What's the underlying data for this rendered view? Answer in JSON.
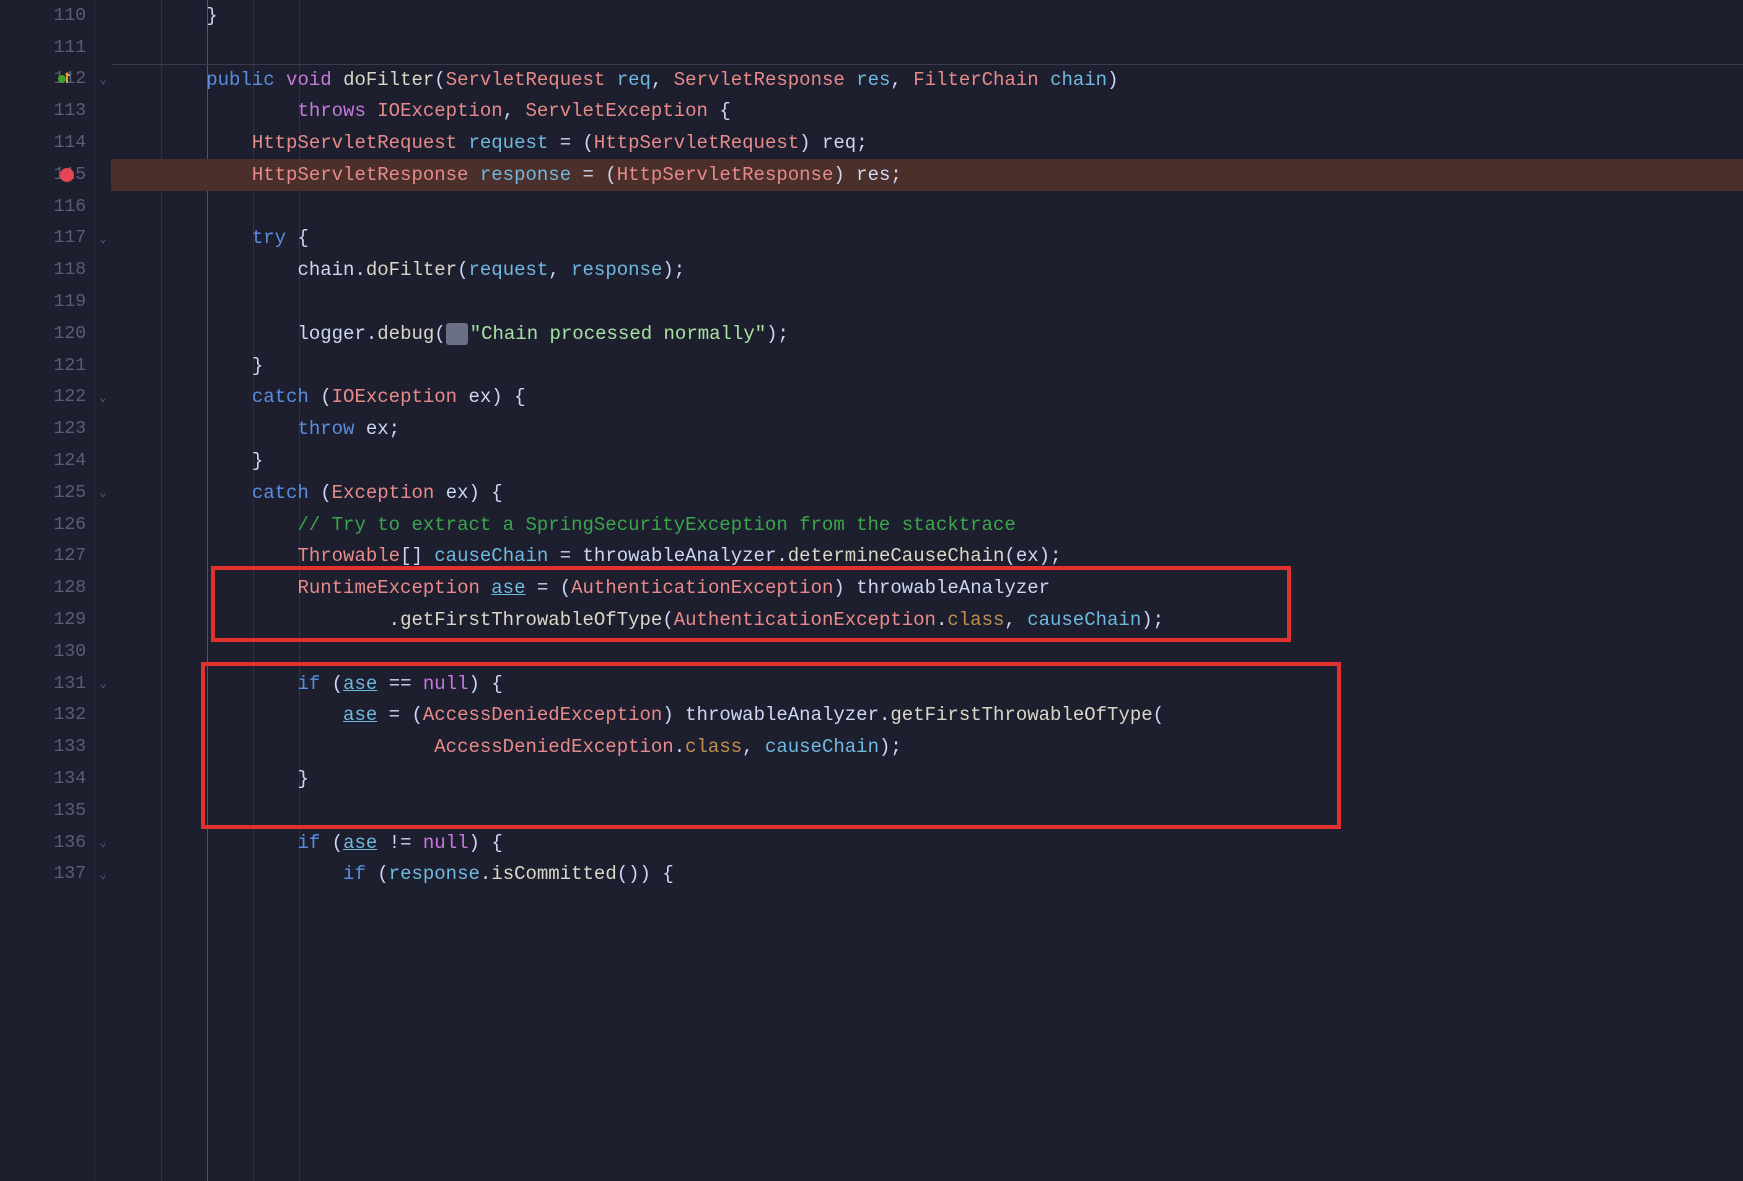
{
  "gutter": {
    "start": 110,
    "end": 137,
    "breakpoint_line": 115,
    "override_line": 112
  },
  "code": {
    "lines": [
      {
        "n": 110,
        "indent": 2,
        "tokens": [
          [
            "punct",
            "}"
          ]
        ]
      },
      {
        "n": 111,
        "indent": 0,
        "tokens": []
      },
      {
        "n": 112,
        "indent": 2,
        "ruler": true,
        "tokens": [
          [
            "kw",
            "public"
          ],
          [
            "sp",
            " "
          ],
          [
            "kw2",
            "void"
          ],
          [
            "sp",
            " "
          ],
          [
            "method",
            "doFilter"
          ],
          [
            "punct",
            "("
          ],
          [
            "type",
            "ServletRequest"
          ],
          [
            "sp",
            " "
          ],
          [
            "var",
            "req"
          ],
          [
            "punct",
            ", "
          ],
          [
            "type",
            "ServletResponse"
          ],
          [
            "sp",
            " "
          ],
          [
            "var",
            "res"
          ],
          [
            "punct",
            ", "
          ],
          [
            "type",
            "FilterChain"
          ],
          [
            "sp",
            " "
          ],
          [
            "var",
            "chain"
          ],
          [
            "punct",
            ")"
          ]
        ]
      },
      {
        "n": 113,
        "indent": 4,
        "tokens": [
          [
            "kw2",
            "throws"
          ],
          [
            "sp",
            " "
          ],
          [
            "type",
            "IOException"
          ],
          [
            "punct",
            ", "
          ],
          [
            "type",
            "ServletException"
          ],
          [
            "sp",
            " "
          ],
          [
            "punct",
            "{"
          ]
        ]
      },
      {
        "n": 114,
        "indent": 3,
        "tokens": [
          [
            "type",
            "HttpServletRequest"
          ],
          [
            "sp",
            " "
          ],
          [
            "var",
            "request"
          ],
          [
            "sp",
            " "
          ],
          [
            "punct",
            "= ("
          ],
          [
            "type",
            "HttpServletRequest"
          ],
          [
            "punct",
            ") "
          ],
          [
            "ident",
            "req"
          ],
          [
            "punct",
            ";"
          ]
        ]
      },
      {
        "n": 115,
        "indent": 3,
        "hl": "bp",
        "tokens": [
          [
            "type",
            "HttpServletResponse"
          ],
          [
            "sp",
            " "
          ],
          [
            "var",
            "response"
          ],
          [
            "sp",
            " "
          ],
          [
            "punct",
            "= ("
          ],
          [
            "type",
            "HttpServletResponse"
          ],
          [
            "punct",
            ") "
          ],
          [
            "ident",
            "res"
          ],
          [
            "punct",
            ";"
          ]
        ]
      },
      {
        "n": 116,
        "indent": 0,
        "tokens": []
      },
      {
        "n": 117,
        "indent": 3,
        "tokens": [
          [
            "kw",
            "try"
          ],
          [
            "sp",
            " "
          ],
          [
            "punct",
            "{"
          ]
        ]
      },
      {
        "n": 118,
        "indent": 4,
        "tokens": [
          [
            "ident",
            "chain"
          ],
          [
            "punct",
            "."
          ],
          [
            "method",
            "doFilter"
          ],
          [
            "punct",
            "("
          ],
          [
            "var",
            "request"
          ],
          [
            "punct",
            ", "
          ],
          [
            "var",
            "response"
          ],
          [
            "punct",
            ");"
          ]
        ]
      },
      {
        "n": 119,
        "indent": 0,
        "tokens": []
      },
      {
        "n": 120,
        "indent": 4,
        "tokens": [
          [
            "ident",
            "logger"
          ],
          [
            "punct",
            "."
          ],
          [
            "method",
            "debug"
          ],
          [
            "punct",
            "("
          ],
          [
            "hint",
            ""
          ],
          [
            "str",
            "\"Chain processed normally\""
          ],
          [
            "punct",
            ");"
          ]
        ]
      },
      {
        "n": 121,
        "indent": 3,
        "tokens": [
          [
            "punct",
            "}"
          ]
        ]
      },
      {
        "n": 122,
        "indent": 3,
        "tokens": [
          [
            "kw",
            "catch"
          ],
          [
            "sp",
            " "
          ],
          [
            "punct",
            "("
          ],
          [
            "type",
            "IOException"
          ],
          [
            "sp",
            " "
          ],
          [
            "ident",
            "ex"
          ],
          [
            "punct",
            ") {"
          ]
        ]
      },
      {
        "n": 123,
        "indent": 4,
        "tokens": [
          [
            "kw",
            "throw"
          ],
          [
            "sp",
            " "
          ],
          [
            "ident",
            "ex"
          ],
          [
            "punct",
            ";"
          ]
        ]
      },
      {
        "n": 124,
        "indent": 3,
        "tokens": [
          [
            "punct",
            "}"
          ]
        ]
      },
      {
        "n": 125,
        "indent": 3,
        "tokens": [
          [
            "kw",
            "catch"
          ],
          [
            "sp",
            " "
          ],
          [
            "punct",
            "("
          ],
          [
            "type",
            "Exception"
          ],
          [
            "sp",
            " "
          ],
          [
            "ident",
            "ex"
          ],
          [
            "punct",
            ") {"
          ]
        ]
      },
      {
        "n": 126,
        "indent": 4,
        "tokens": [
          [
            "comment",
            "// Try to extract a SpringSecurityException from the stacktrace"
          ]
        ]
      },
      {
        "n": 127,
        "indent": 4,
        "tokens": [
          [
            "type",
            "Throwable"
          ],
          [
            "punct",
            "[] "
          ],
          [
            "var",
            "causeChain"
          ],
          [
            "sp",
            " "
          ],
          [
            "punct",
            "= "
          ],
          [
            "ident",
            "throwableAnalyzer"
          ],
          [
            "punct",
            "."
          ],
          [
            "method",
            "determineCauseChain"
          ],
          [
            "punct",
            "("
          ],
          [
            "ident",
            "ex"
          ],
          [
            "punct",
            ");"
          ]
        ]
      },
      {
        "n": 128,
        "indent": 4,
        "tokens": [
          [
            "type",
            "RuntimeException"
          ],
          [
            "sp",
            " "
          ],
          [
            "varU",
            "ase"
          ],
          [
            "sp",
            " "
          ],
          [
            "punct",
            "= ("
          ],
          [
            "type",
            "AuthenticationException"
          ],
          [
            "punct",
            ") "
          ],
          [
            "ident",
            "throwableAnalyzer"
          ]
        ]
      },
      {
        "n": 129,
        "indent": 6,
        "tokens": [
          [
            "punct",
            "."
          ],
          [
            "method",
            "getFirstThrowableOfType"
          ],
          [
            "punct",
            "("
          ],
          [
            "type",
            "AuthenticationException"
          ],
          [
            "punct",
            "."
          ],
          [
            "field",
            "class"
          ],
          [
            "punct",
            ", "
          ],
          [
            "var",
            "causeChain"
          ],
          [
            "punct",
            ");"
          ]
        ]
      },
      {
        "n": 130,
        "indent": 0,
        "tokens": []
      },
      {
        "n": 131,
        "indent": 4,
        "tokens": [
          [
            "kw",
            "if"
          ],
          [
            "sp",
            " "
          ],
          [
            "punct",
            "("
          ],
          [
            "varU",
            "ase"
          ],
          [
            "sp",
            " "
          ],
          [
            "punct",
            "== "
          ],
          [
            "null",
            "null"
          ],
          [
            "punct",
            ") {"
          ]
        ]
      },
      {
        "n": 132,
        "indent": 5,
        "tokens": [
          [
            "varU",
            "ase"
          ],
          [
            "sp",
            " "
          ],
          [
            "punct",
            "= ("
          ],
          [
            "type",
            "AccessDeniedException"
          ],
          [
            "punct",
            ") "
          ],
          [
            "ident",
            "throwableAnalyzer"
          ],
          [
            "punct",
            "."
          ],
          [
            "method",
            "getFirstThrowableOfType"
          ],
          [
            "punct",
            "("
          ]
        ]
      },
      {
        "n": 133,
        "indent": 7,
        "tokens": [
          [
            "type",
            "AccessDeniedException"
          ],
          [
            "punct",
            "."
          ],
          [
            "field",
            "class"
          ],
          [
            "punct",
            ", "
          ],
          [
            "var",
            "causeChain"
          ],
          [
            "punct",
            ");"
          ]
        ]
      },
      {
        "n": 134,
        "indent": 4,
        "tokens": [
          [
            "punct",
            "}"
          ]
        ]
      },
      {
        "n": 135,
        "indent": 0,
        "tokens": []
      },
      {
        "n": 136,
        "indent": 4,
        "tokens": [
          [
            "kw",
            "if"
          ],
          [
            "sp",
            " "
          ],
          [
            "punct",
            "("
          ],
          [
            "varU",
            "ase"
          ],
          [
            "sp",
            " "
          ],
          [
            "punct",
            "!= "
          ],
          [
            "null",
            "null"
          ],
          [
            "punct",
            ") {"
          ]
        ]
      },
      {
        "n": 137,
        "indent": 5,
        "tokens": [
          [
            "kw",
            "if"
          ],
          [
            "sp",
            " "
          ],
          [
            "punct",
            "("
          ],
          [
            "var",
            "response"
          ],
          [
            "punct",
            "."
          ],
          [
            "method",
            "isCommitted"
          ],
          [
            "punct",
            "()) {"
          ]
        ]
      }
    ]
  },
  "annotations": {
    "box1": {
      "startLine": 128,
      "endLine": 129
    },
    "box2": {
      "startLine": 131,
      "endLine": 134
    }
  },
  "colors": {
    "keyword": "#89b4fa",
    "keyword2": "#f38ba8",
    "type": "#f38ba8",
    "method": "#f9e2af",
    "var": "#89dceb",
    "string": "#a6e3a1",
    "comment": "#40a02b",
    "breakpoint_bg": "#4a2f2a",
    "breakpoint_dot": "#e64553",
    "annot_border": "#e03030"
  }
}
